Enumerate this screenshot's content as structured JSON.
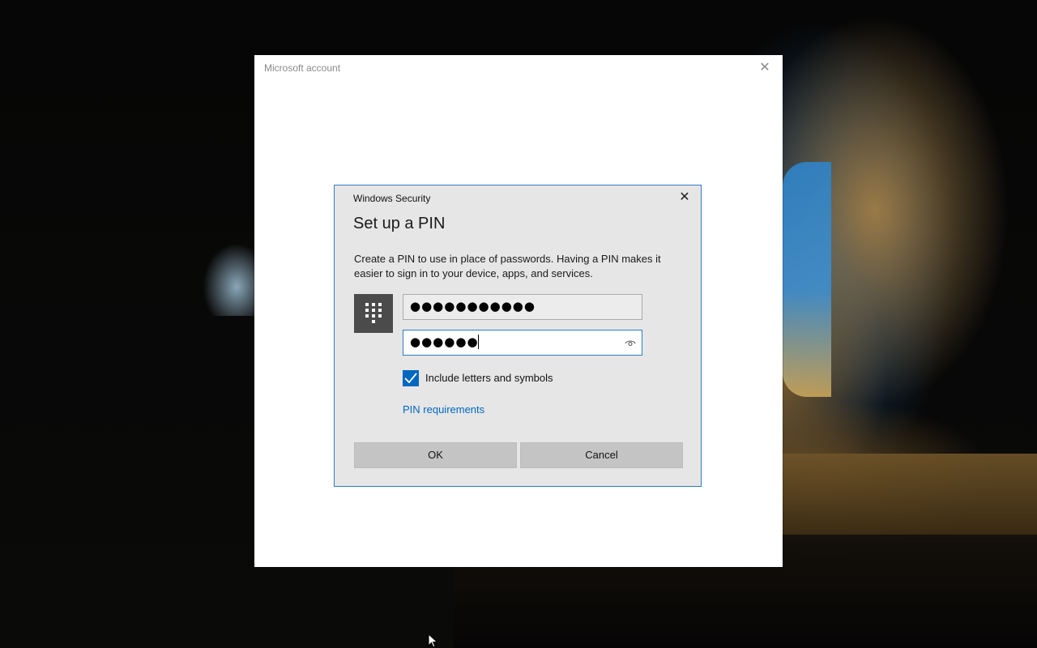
{
  "outer_window": {
    "title": "Microsoft account",
    "close_glyph": "✕"
  },
  "dialog": {
    "app_name": "Windows Security",
    "close_glyph": "✕",
    "heading": "Set up a PIN",
    "description": "Create a PIN to use in place of passwords. Having a PIN makes it easier to sign in to your device, apps, and services.",
    "pin_icon": "keypad-icon",
    "new_pin": {
      "value": "●●●●●●●●●●●",
      "type": "password"
    },
    "confirm_pin": {
      "value": "●●●●●●",
      "type": "password",
      "focused": true,
      "reveal_icon": "eye-icon"
    },
    "checkbox": {
      "label": "Include letters and symbols",
      "checked": true
    },
    "link_text": "PIN requirements",
    "ok_label": "OK",
    "cancel_label": "Cancel"
  },
  "colors": {
    "accent": "#0067c0",
    "dialog_border": "#2c7cc5",
    "dialog_bg": "#e6e6e6",
    "button_bg": "#c4c4c4"
  }
}
